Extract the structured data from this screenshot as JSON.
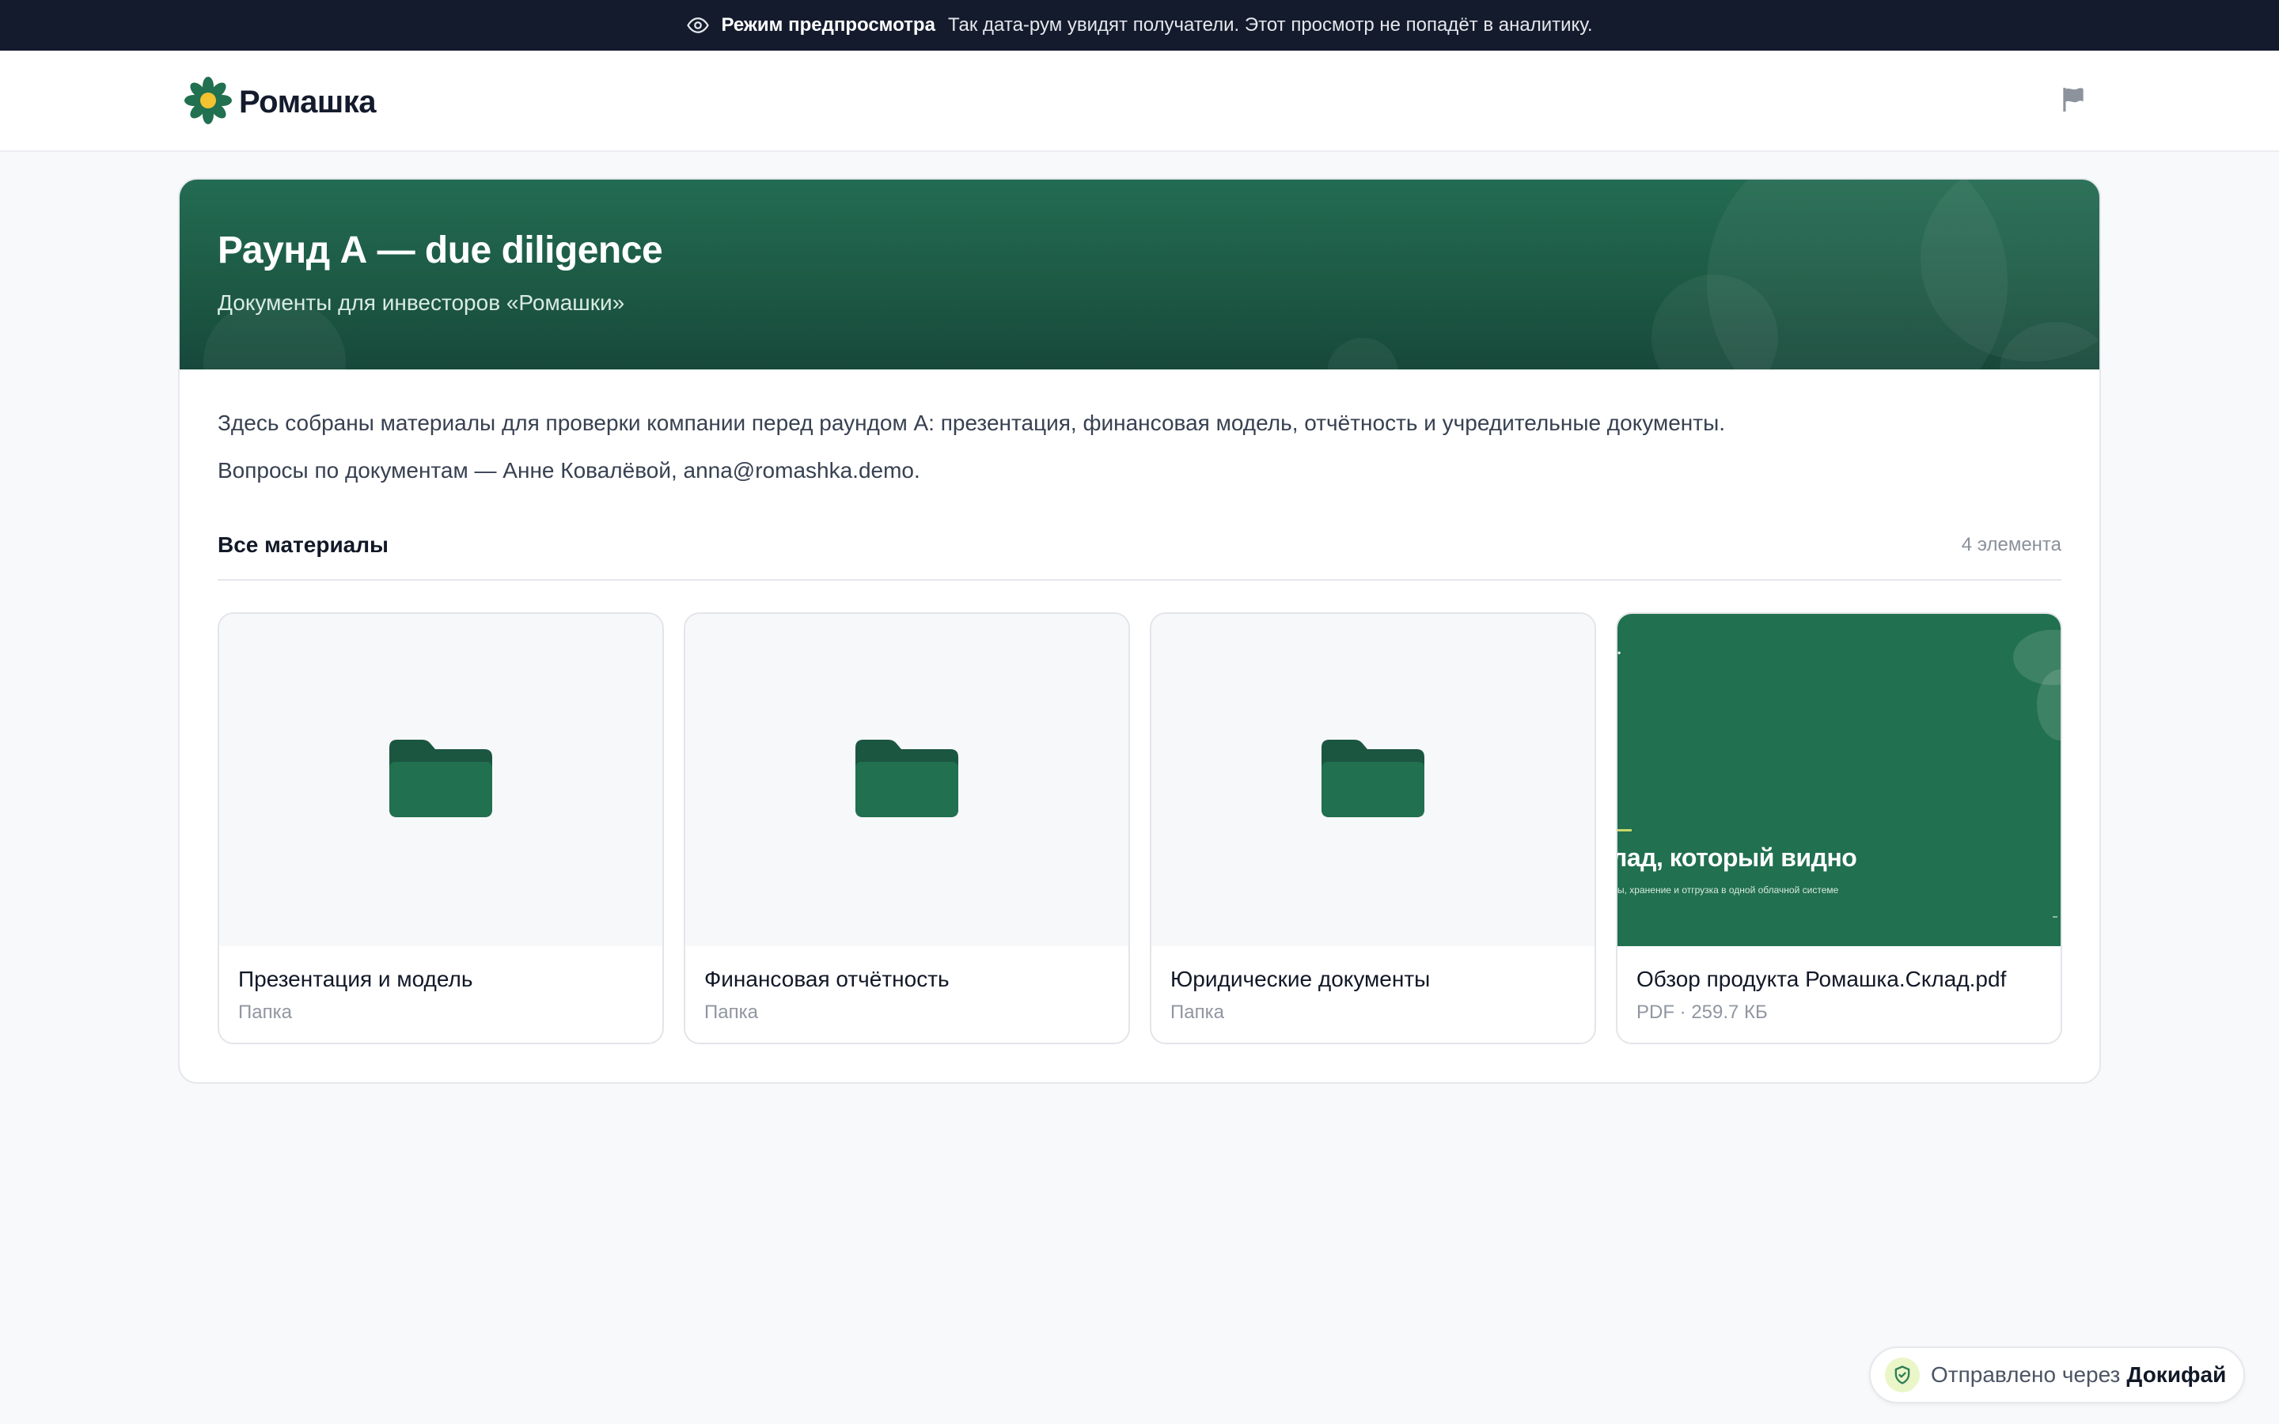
{
  "banner": {
    "mode_label": "Режим предпросмотра",
    "text": "Так дата-рум увидят получатели. Этот просмотр не попадёт в аналитику."
  },
  "header": {
    "logo_text": "Ромашка",
    "icons": [
      "daisy-logo-icon",
      "flag-icon"
    ]
  },
  "hero": {
    "title": "Раунд А — due diligence",
    "subtitle": "Документы для инвесторов «Ромашки»"
  },
  "description": {
    "line1": "Здесь собраны материалы для проверки компании перед раундом А: презентация, финансовая модель, отчётность и учредительные документы.",
    "line2": "Вопросы по документам — Анне Ковалёвой, anna@romashka.demo."
  },
  "section": {
    "title": "Все материалы",
    "count": "4 элемента"
  },
  "items": [
    {
      "name": "Презентация и модель",
      "meta": "Папка",
      "icon": "folder-icon"
    },
    {
      "name": "Финансовая отчётность",
      "meta": "Папка",
      "icon": "folder-icon"
    },
    {
      "name": "Юридические документы",
      "meta": "Папка",
      "icon": "folder-icon"
    },
    {
      "name": "Обзор продукта Ромашка.Склад.pdf",
      "meta": "PDF · 259.7 КБ",
      "icon": "pdf-preview"
    }
  ],
  "pdf_preview": {
    "headline": "лад, который видно",
    "subline": "ы, хранение и отгрузка в одной облачной системе"
  },
  "powered_by": {
    "prefix": "Отправлено через",
    "brand": "Докифай"
  },
  "colors": {
    "banner_bg": "#141b2d",
    "brand_green": "#21704f",
    "hero_green": "#1d5a45",
    "daisy_yellow": "#f2c230",
    "page_bg": "#f8f9fb"
  }
}
